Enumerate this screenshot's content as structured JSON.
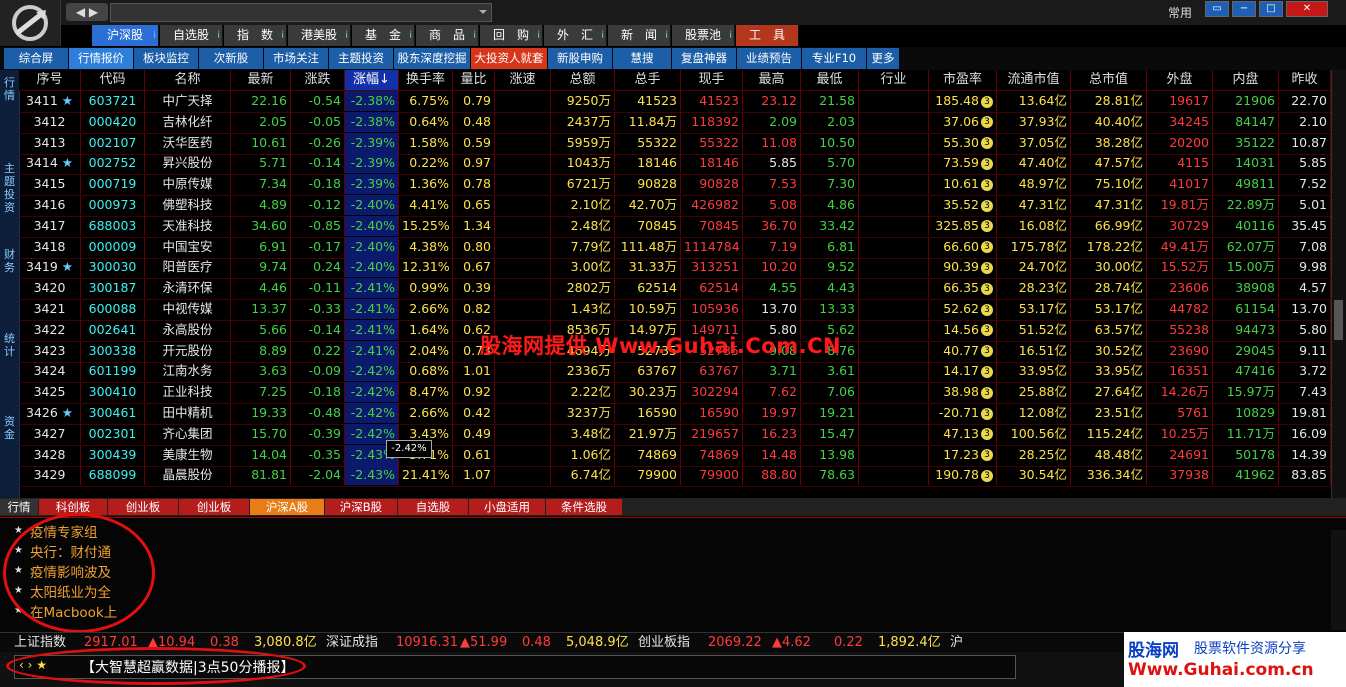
{
  "topbar": {
    "nav_arrows": "◀ ▶",
    "user_label": "常用",
    "window_buttons": [
      "▭",
      "−",
      "□",
      "✕"
    ]
  },
  "main_nav": [
    {
      "label": "沪深股",
      "info": "i",
      "active": true
    },
    {
      "label": "自选股",
      "info": "i"
    },
    {
      "label": "指　数",
      "info": "i"
    },
    {
      "label": "港美股",
      "info": "i"
    },
    {
      "label": "基　金",
      "info": "i"
    },
    {
      "label": "商　品",
      "info": "i"
    },
    {
      "label": "回　购",
      "info": "i"
    },
    {
      "label": "外　汇",
      "info": "i"
    },
    {
      "label": "新　闻",
      "info": "i"
    },
    {
      "label": "股票池",
      "info": "i"
    },
    {
      "label": "工　具",
      "info": ""
    }
  ],
  "sub_nav": [
    "综合屏",
    "行情报价",
    "板块监控",
    "次新股",
    "市场关注",
    "主题投资",
    "股东深度挖掘",
    "大投资人就套",
    "新股申购",
    "慧搜",
    "复盘神器",
    "业绩预告",
    "专业F10",
    "更多"
  ],
  "left_tabs": [
    "行情",
    "主题投资",
    "财务",
    "统计",
    "资金"
  ],
  "table": {
    "headers": [
      "序号",
      "代码",
      "名称",
      "最新",
      "涨跌",
      "涨幅↓",
      "换手率",
      "量比",
      "涨速",
      "总额",
      "总手",
      "现手",
      "最高",
      "最低",
      "行业",
      "市盈率",
      "流通市值",
      "总市值",
      "外盘",
      "内盘",
      "昨收"
    ],
    "rows": [
      {
        "no": "3411",
        "star": true,
        "code": "603721",
        "name": "中广天择",
        "last": "22.16",
        "chg": "-0.54",
        "pct": "-2.38%",
        "turn": "6.75%",
        "vr": "0.79",
        "amt": "9250万",
        "vol": "41523",
        "cur": "41523",
        "high": "23.12",
        "low": "21.58",
        "pe": "185.48",
        "float": "13.64亿",
        "mcap": "28.81亿",
        "out": "19617",
        "in": "21906",
        "prev": "22.70"
      },
      {
        "no": "3412",
        "star": false,
        "code": "000420",
        "name": "吉林化纤",
        "last": "2.05",
        "chg": "-0.05",
        "pct": "-2.38%",
        "turn": "0.64%",
        "vr": "0.48",
        "amt": "2437万",
        "vol": "11.84万",
        "cur": "118392",
        "high": "2.09",
        "low": "2.03",
        "pe": "37.06",
        "float": "37.93亿",
        "mcap": "40.40亿",
        "out": "34245",
        "in": "84147",
        "prev": "2.10"
      },
      {
        "no": "3413",
        "star": false,
        "code": "002107",
        "name": "沃华医药",
        "last": "10.61",
        "chg": "-0.26",
        "pct": "-2.39%",
        "turn": "1.58%",
        "vr": "0.59",
        "amt": "5959万",
        "vol": "55322",
        "cur": "55322",
        "high": "11.08",
        "low": "10.50",
        "pe": "55.30",
        "float": "37.05亿",
        "mcap": "38.28亿",
        "out": "20200",
        "in": "35122",
        "prev": "10.87"
      },
      {
        "no": "3414",
        "star": true,
        "code": "002752",
        "name": "昇兴股份",
        "last": "5.71",
        "chg": "-0.14",
        "pct": "-2.39%",
        "turn": "0.22%",
        "vr": "0.97",
        "amt": "1043万",
        "vol": "18146",
        "cur": "18146",
        "high": "5.85",
        "low": "5.70",
        "pe": "73.59",
        "float": "47.40亿",
        "mcap": "47.57亿",
        "out": "4115",
        "in": "14031",
        "prev": "5.85"
      },
      {
        "no": "3415",
        "star": false,
        "code": "000719",
        "name": "中原传媒",
        "last": "7.34",
        "chg": "-0.18",
        "pct": "-2.39%",
        "turn": "1.36%",
        "vr": "0.78",
        "amt": "6721万",
        "vol": "90828",
        "cur": "90828",
        "high": "7.53",
        "low": "7.30",
        "pe": "10.61",
        "float": "48.97亿",
        "mcap": "75.10亿",
        "out": "41017",
        "in": "49811",
        "prev": "7.52"
      },
      {
        "no": "3416",
        "star": false,
        "code": "000973",
        "name": "佛塑科技",
        "last": "4.89",
        "chg": "-0.12",
        "pct": "-2.40%",
        "turn": "4.41%",
        "vr": "0.65",
        "amt": "2.10亿",
        "vol": "42.70万",
        "cur": "426982",
        "high": "5.08",
        "low": "4.86",
        "pe": "35.52",
        "float": "47.31亿",
        "mcap": "47.31亿",
        "out": "19.81万",
        "in": "22.89万",
        "prev": "5.01"
      },
      {
        "no": "3417",
        "star": false,
        "code": "688003",
        "name": "天准科技",
        "last": "34.60",
        "chg": "-0.85",
        "pct": "-2.40%",
        "turn": "15.25%",
        "vr": "1.34",
        "amt": "2.48亿",
        "vol": "70845",
        "cur": "70845",
        "high": "36.70",
        "low": "33.42",
        "pe": "325.85",
        "float": "16.08亿",
        "mcap": "66.99亿",
        "out": "30729",
        "in": "40116",
        "prev": "35.45"
      },
      {
        "no": "3418",
        "star": false,
        "code": "000009",
        "name": "中国宝安",
        "last": "6.91",
        "chg": "-0.17",
        "pct": "-2.40%",
        "turn": "4.38%",
        "vr": "0.80",
        "amt": "7.79亿",
        "vol": "111.48万",
        "cur": "1114784",
        "high": "7.19",
        "low": "6.81",
        "pe": "66.60",
        "float": "175.78亿",
        "mcap": "178.22亿",
        "out": "49.41万",
        "in": "62.07万",
        "prev": "7.08"
      },
      {
        "no": "3419",
        "star": true,
        "code": "300030",
        "name": "阳普医疗",
        "last": "9.74",
        "chg": "0.24",
        "pct": "-2.40%",
        "turn": "12.31%",
        "vr": "0.67",
        "amt": "3.00亿",
        "vol": "31.33万",
        "cur": "313251",
        "high": "10.20",
        "low": "9.52",
        "pe": "90.39",
        "float": "24.70亿",
        "mcap": "30.00亿",
        "out": "15.52万",
        "in": "15.00万",
        "prev": "9.98"
      },
      {
        "no": "3420",
        "star": false,
        "code": "300187",
        "name": "永清环保",
        "last": "4.46",
        "chg": "-0.11",
        "pct": "-2.41%",
        "turn": "0.99%",
        "vr": "0.39",
        "amt": "2802万",
        "vol": "62514",
        "cur": "62514",
        "high": "4.55",
        "low": "4.43",
        "pe": "66.35",
        "float": "28.23亿",
        "mcap": "28.74亿",
        "out": "23606",
        "in": "38908",
        "prev": "4.57"
      },
      {
        "no": "3421",
        "star": false,
        "code": "600088",
        "name": "中视传媒",
        "last": "13.37",
        "chg": "-0.33",
        "pct": "-2.41%",
        "turn": "2.66%",
        "vr": "0.82",
        "amt": "1.43亿",
        "vol": "10.59万",
        "cur": "105936",
        "high": "13.70",
        "low": "13.33",
        "pe": "52.62",
        "float": "53.17亿",
        "mcap": "53.17亿",
        "out": "44782",
        "in": "61154",
        "prev": "13.70"
      },
      {
        "no": "3422",
        "star": false,
        "code": "002641",
        "name": "永高股份",
        "last": "5.66",
        "chg": "-0.14",
        "pct": "-2.41%",
        "turn": "1.64%",
        "vr": "0.62",
        "amt": "8536万",
        "vol": "14.97万",
        "cur": "149711",
        "high": "5.80",
        "low": "5.62",
        "pe": "14.56",
        "float": "51.52亿",
        "mcap": "63.57亿",
        "out": "55238",
        "in": "94473",
        "prev": "5.80"
      },
      {
        "no": "3423",
        "star": false,
        "code": "300338",
        "name": "开元股份",
        "last": "8.89",
        "chg": "0.22",
        "pct": "-2.41%",
        "turn": "2.04%",
        "vr": "0.73",
        "amt": "4694万",
        "vol": "52735",
        "cur": "52735",
        "high": "9.08",
        "low": "8.76",
        "pe": "40.77",
        "float": "16.51亿",
        "mcap": "30.52亿",
        "out": "23690",
        "in": "29045",
        "prev": "9.11"
      },
      {
        "no": "3424",
        "star": false,
        "code": "601199",
        "name": "江南水务",
        "last": "3.63",
        "chg": "-0.09",
        "pct": "-2.42%",
        "turn": "0.68%",
        "vr": "1.01",
        "amt": "2336万",
        "vol": "63767",
        "cur": "63767",
        "high": "3.71",
        "low": "3.61",
        "pe": "14.17",
        "float": "33.95亿",
        "mcap": "33.95亿",
        "out": "16351",
        "in": "47416",
        "prev": "3.72"
      },
      {
        "no": "3425",
        "star": false,
        "code": "300410",
        "name": "正业科技",
        "last": "7.25",
        "chg": "-0.18",
        "pct": "-2.42%",
        "turn": "8.47%",
        "vr": "0.92",
        "amt": "2.22亿",
        "vol": "30.23万",
        "cur": "302294",
        "high": "7.62",
        "low": "7.06",
        "pe": "38.98",
        "float": "25.88亿",
        "mcap": "27.64亿",
        "out": "14.26万",
        "in": "15.97万",
        "prev": "7.43"
      },
      {
        "no": "3426",
        "star": true,
        "code": "300461",
        "name": "田中精机",
        "last": "19.33",
        "chg": "-0.48",
        "pct": "-2.42%",
        "turn": "2.66%",
        "vr": "0.42",
        "amt": "3237万",
        "vol": "16590",
        "cur": "16590",
        "high": "19.97",
        "low": "19.21",
        "pe": "-20.71",
        "float": "12.08亿",
        "mcap": "23.51亿",
        "out": "5761",
        "in": "10829",
        "prev": "19.81"
      },
      {
        "no": "3427",
        "star": false,
        "code": "002301",
        "name": "齐心集团",
        "last": "15.70",
        "chg": "-0.39",
        "pct": "-2.42%",
        "turn": "3.43%",
        "vr": "0.49",
        "amt": "3.48亿",
        "vol": "21.97万",
        "cur": "219657",
        "high": "16.23",
        "low": "15.47",
        "pe": "47.13",
        "float": "100.56亿",
        "mcap": "115.24亿",
        "out": "10.25万",
        "in": "11.71万",
        "prev": "16.09"
      },
      {
        "no": "3428",
        "star": false,
        "code": "300439",
        "name": "美康生物",
        "last": "14.04",
        "chg": "-0.35",
        "pct": "-2.43%",
        "turn": "5.71%",
        "vr": "0.61",
        "amt": "1.06亿",
        "vol": "74869",
        "cur": "74869",
        "high": "14.48",
        "low": "13.98",
        "pe": "17.23",
        "float": "28.25亿",
        "mcap": "48.48亿",
        "out": "24691",
        "in": "50178",
        "prev": "14.39"
      },
      {
        "no": "3429",
        "star": false,
        "code": "688099",
        "name": "晶晨股份",
        "last": "81.81",
        "chg": "-2.04",
        "pct": "-2.43%",
        "turn": "21.41%",
        "vr": "1.07",
        "amt": "6.74亿",
        "vol": "79900",
        "cur": "79900",
        "high": "88.80",
        "low": "78.63",
        "pe": "190.78",
        "float": "30.54亿",
        "mcap": "336.34亿",
        "out": "37938",
        "in": "41962",
        "prev": "83.85"
      }
    ]
  },
  "tooltip_pct": "-2.42%",
  "watermark": "股海网提供 Www.Guhai.Com.CN",
  "bottom_tabs": [
    "行情",
    "科创板",
    "创业板",
    "创业板",
    "沪深A股",
    "沪深B股",
    "自选股",
    "小盘适用",
    "条件选股"
  ],
  "news": [
    "疫情专家组",
    "央行：财付通",
    "疫情影响波及",
    "太阳纸业为全",
    "在Macbook上"
  ],
  "index_ticker": [
    {
      "name": "上证指数",
      "value": "2917.01",
      "chg": "▲10.94",
      "pct": "0.38",
      "amt": "3,080.8亿"
    },
    {
      "name": "深证成指",
      "value": "10916.31",
      "chg": "▲51.99",
      "pct": "0.48",
      "amt": "5,048.9亿"
    },
    {
      "name": "创业板指",
      "value": "2069.22",
      "chg": "▲4.62",
      "pct": "0.22",
      "amt": "1,892.4亿"
    },
    {
      "name": "沪",
      "value": "",
      "chg": "",
      "pct": "",
      "amt": ""
    }
  ],
  "announcement": "【大智慧超赢数据|3点50分播报】",
  "brand": {
    "line1": "股海网",
    "line1b": "股票软件资源分享",
    "line2": "Www.Guhai.com.cn"
  },
  "colors": {
    "up": "#ff3b3b",
    "down": "#46d046",
    "accent_blue": "#2a6ed6",
    "tab_red": "#b51d1d"
  }
}
